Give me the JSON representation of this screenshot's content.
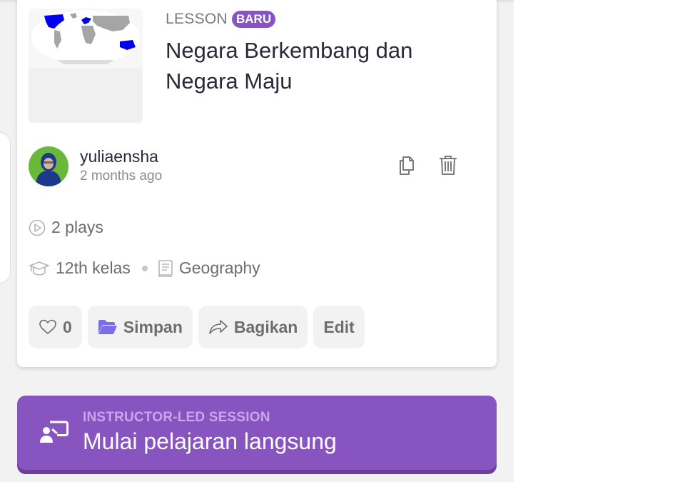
{
  "colors": {
    "accent": "#8854c0",
    "accent_dark": "#6c3f9e",
    "page_bg": "#f2f2f2",
    "text_primary": "#292a3a",
    "text_secondary": "#6d6d6d",
    "folder_icon": "#7c6fe6",
    "map_highlight": "#0000ee"
  },
  "card": {
    "thumbnail_alt": "World map of developed countries",
    "type_label": "LESSON",
    "badge": "BARU",
    "title": "Negara Berkembang dan Negara Maju",
    "author": {
      "name": "yuliaensha",
      "time": "2 months ago",
      "avatar_icon": "user-avatar"
    },
    "icons": {
      "duplicate": "copy-icon",
      "delete": "trash-icon"
    },
    "plays": "2 plays",
    "grade": "12th kelas",
    "subject": "Geography",
    "actions": {
      "like_count": "0",
      "save_label": "Simpan",
      "share_label": "Bagikan",
      "edit_label": "Edit"
    }
  },
  "session": {
    "kicker": "INSTRUCTOR-LED SESSION",
    "title": "Mulai pelajaran langsung"
  }
}
